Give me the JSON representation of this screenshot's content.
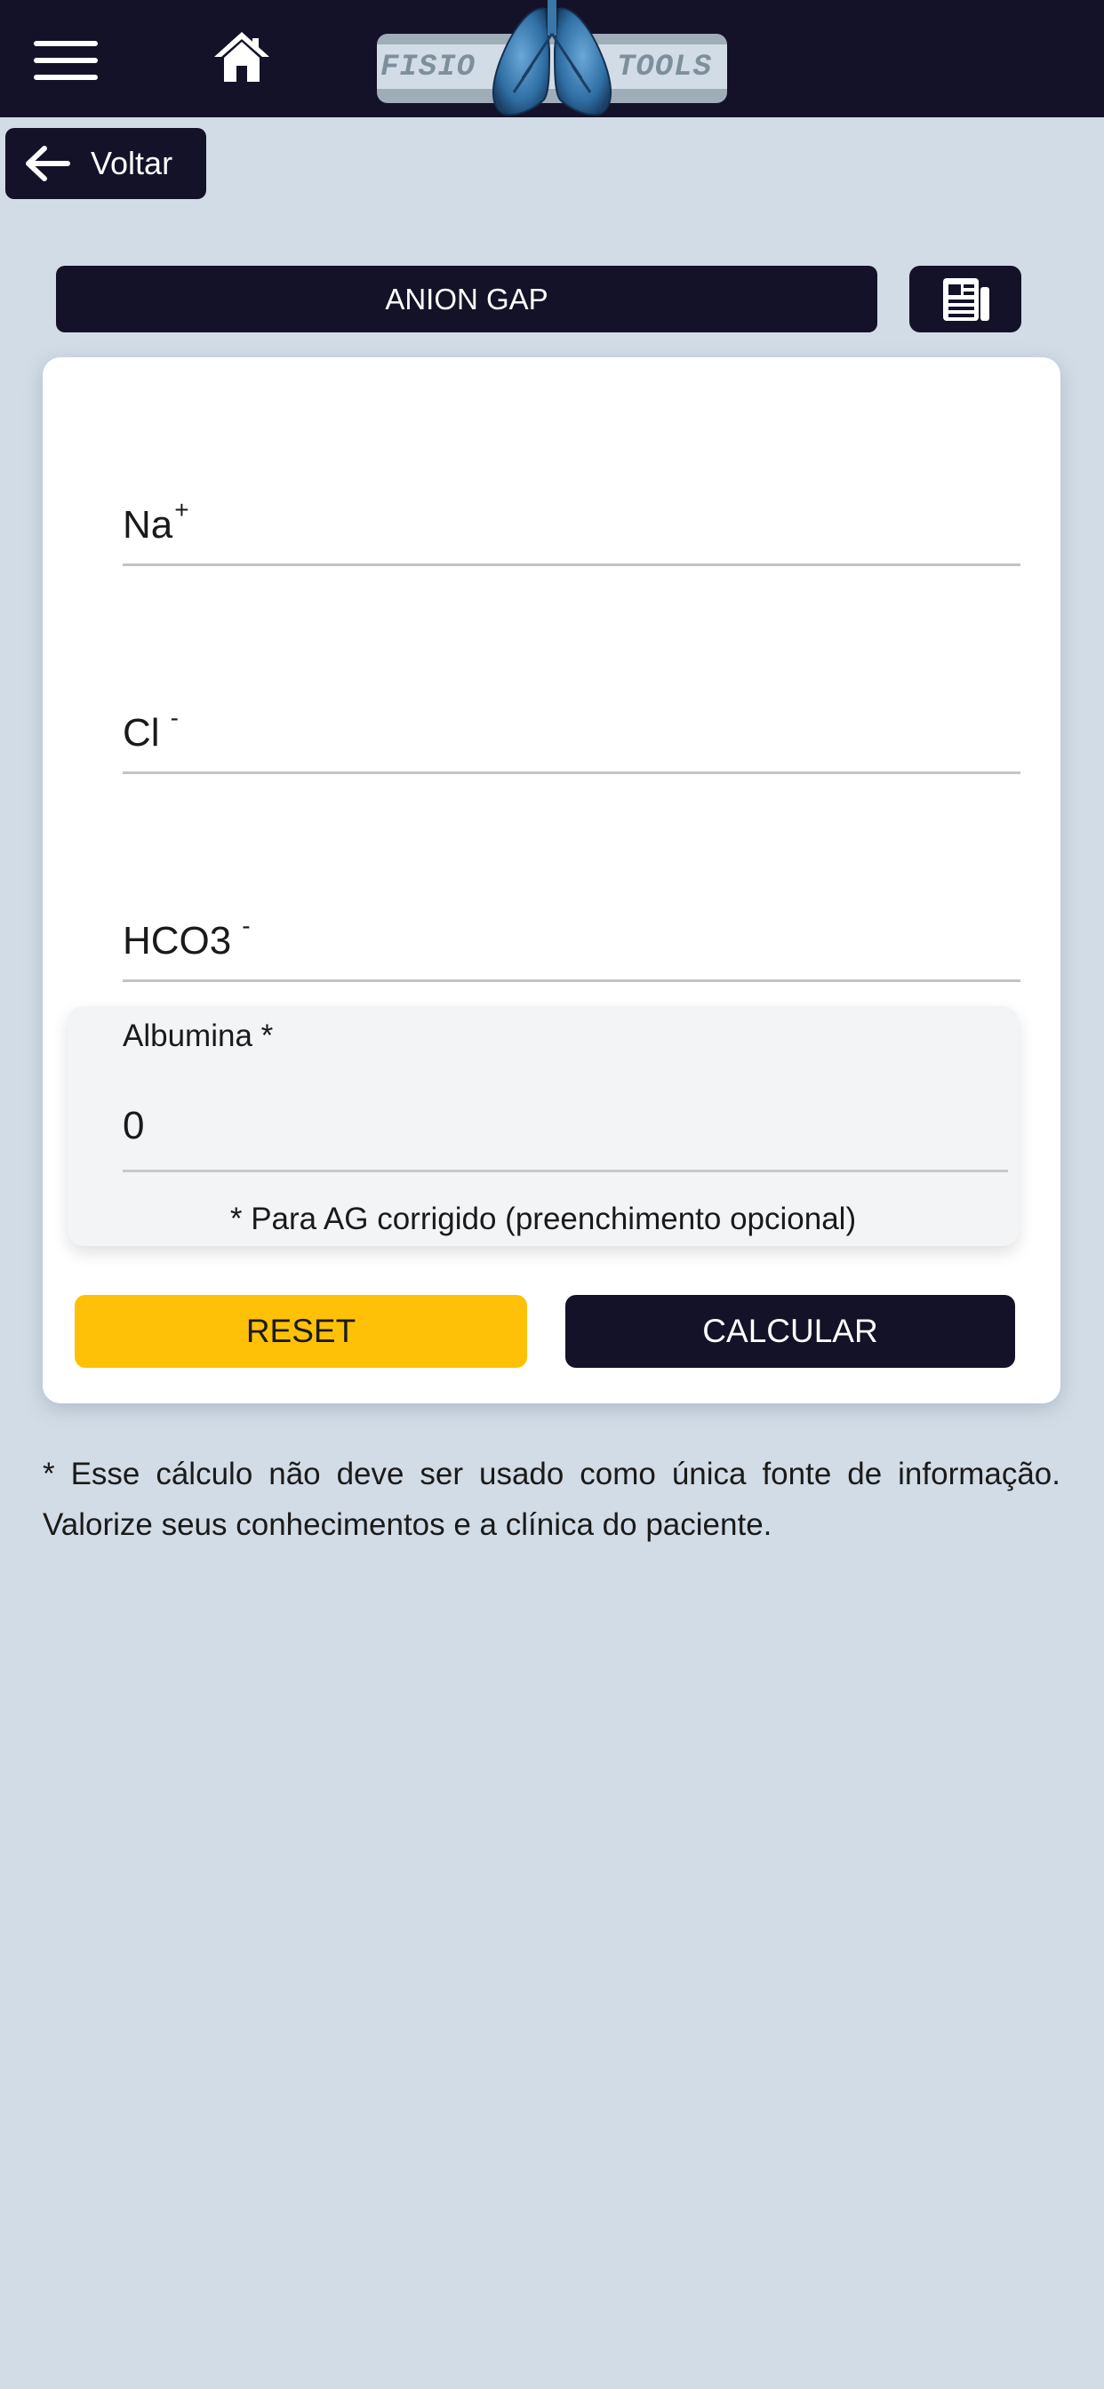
{
  "header": {
    "logo_left": "FISIO",
    "logo_right": "TOOLS"
  },
  "nav": {
    "back_label": "Voltar"
  },
  "calculator": {
    "title": "ANION GAP"
  },
  "fields": [
    {
      "label": "Na",
      "sup": "+"
    },
    {
      "label": "Cl",
      "sup": "-"
    },
    {
      "label": "HCO3",
      "sup": "-"
    }
  ],
  "albumin": {
    "label": "Albumina *",
    "value": "0",
    "note": "* Para AG corrigido (preenchimento opcional)"
  },
  "actions": {
    "reset_label": "RESET",
    "calculate_label": "CALCULAR"
  },
  "disclaimer": "* Esse cálculo não deve ser usado como única fonte de informação. Valorize seus conhecimentos e a clínica do paciente.",
  "colors": {
    "dark": "#141228",
    "page_background": "#d2dce6",
    "reset_yellow": "#ffc107",
    "card": "#ffffff"
  }
}
